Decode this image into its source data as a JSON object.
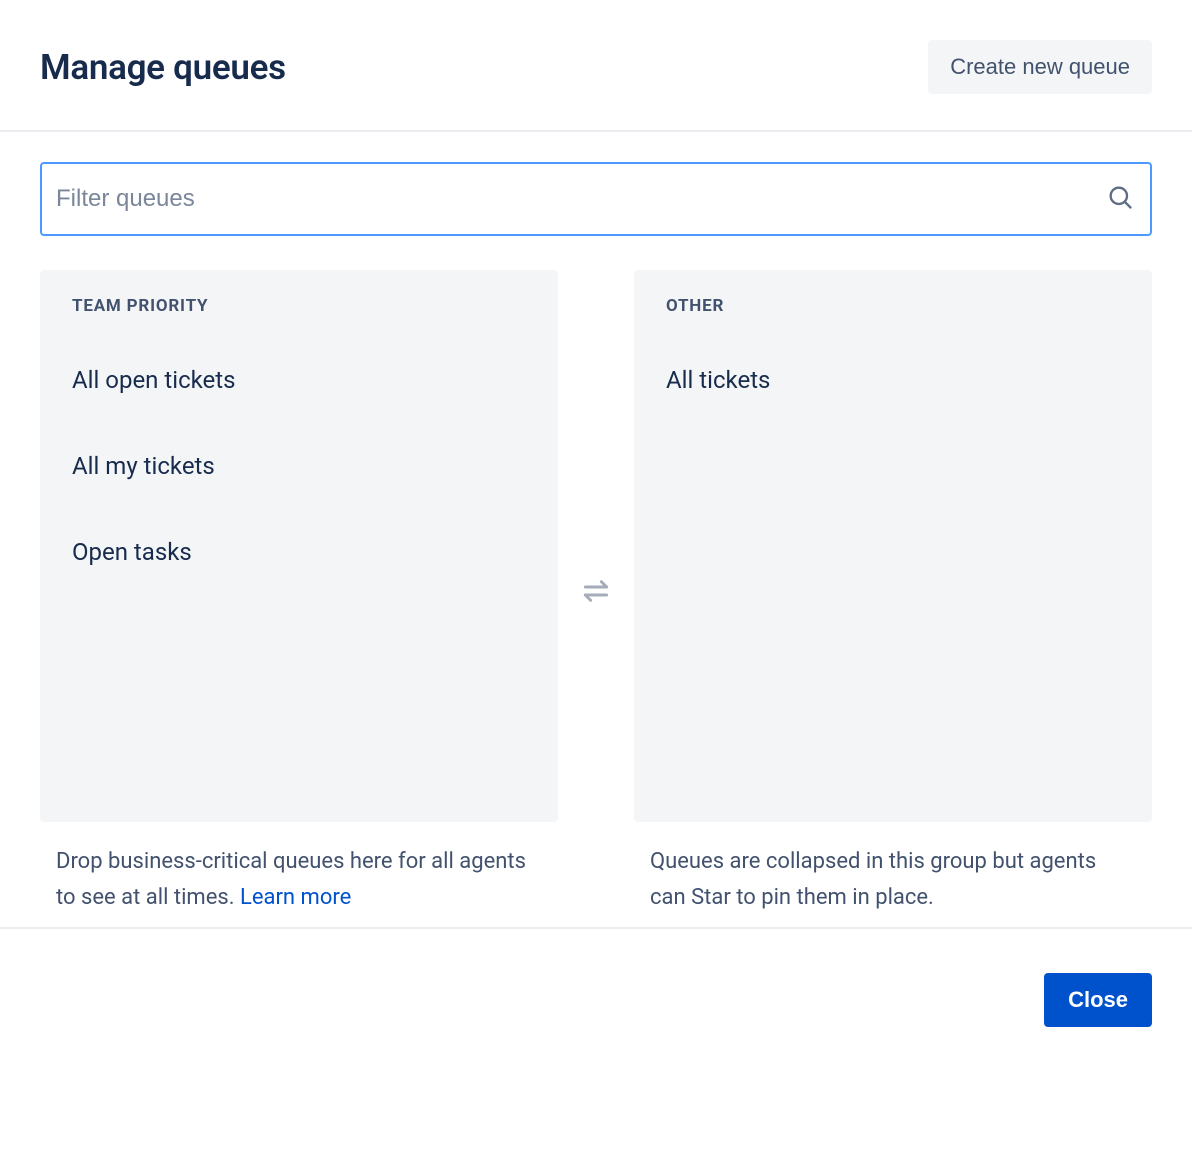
{
  "header": {
    "title": "Manage queues",
    "create_button": "Create new queue"
  },
  "search": {
    "placeholder": "Filter queues"
  },
  "columns": {
    "left": {
      "title": "TEAM PRIORITY",
      "items": [
        "All open tickets",
        "All my tickets",
        "Open tasks"
      ],
      "description": "Drop business-critical queues here for all agents to see at all times. ",
      "learn_more": "Learn more"
    },
    "right": {
      "title": "OTHER",
      "items": [
        "All tickets"
      ],
      "description": "Queues are collapsed in this group but agents can Star to pin them in place."
    }
  },
  "footer": {
    "close": "Close"
  }
}
